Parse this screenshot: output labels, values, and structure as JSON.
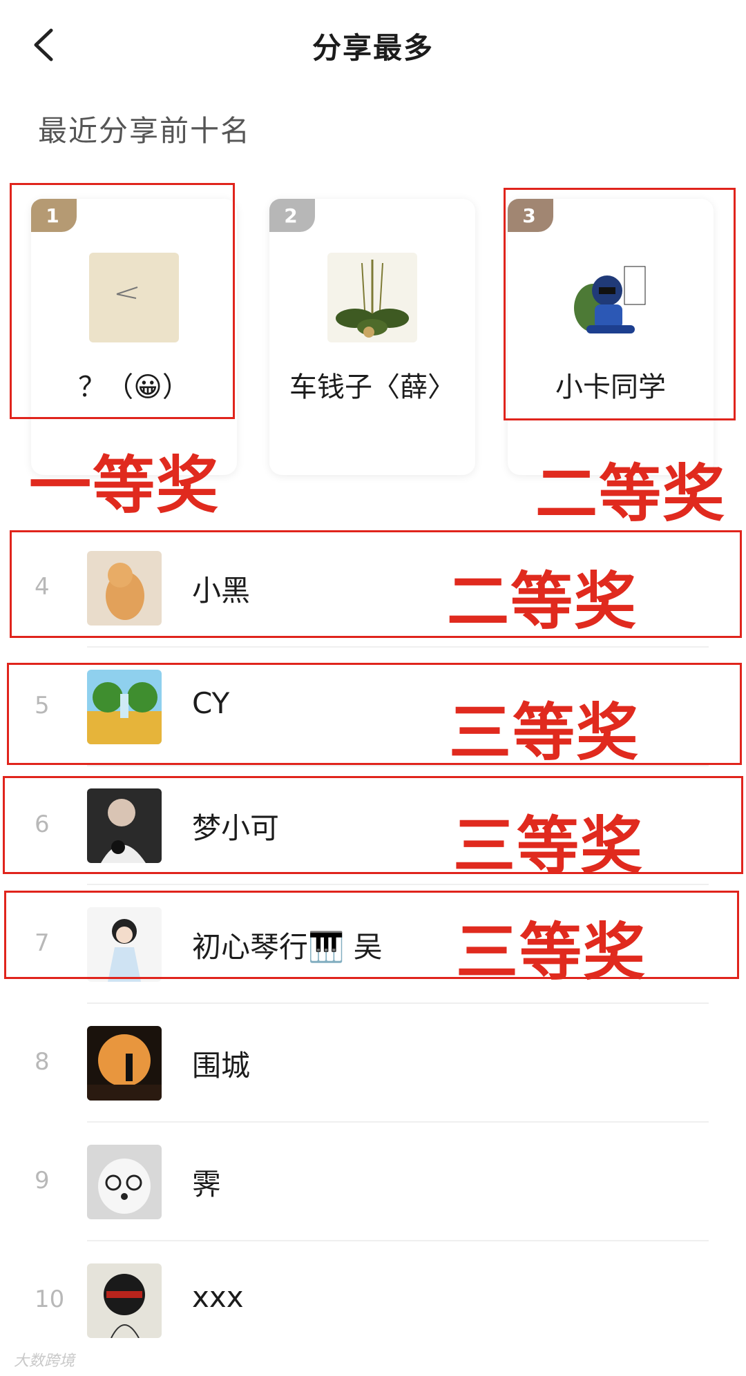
{
  "header": {
    "title": "分享最多",
    "back_icon": "chevron-left-icon"
  },
  "section_title": "最近分享前十名",
  "top3": [
    {
      "rank": "1",
      "name": "？（😀）",
      "badge_color": "#b59a73"
    },
    {
      "rank": "2",
      "name": "车钱子〈薛〉",
      "badge_color": "#b7b7b7"
    },
    {
      "rank": "3",
      "name": "小卡同学",
      "badge_color": "#a18672"
    }
  ],
  "list": [
    {
      "rank": "4",
      "name": "小黑"
    },
    {
      "rank": "5",
      "name": "CY"
    },
    {
      "rank": "6",
      "name": "梦小可"
    },
    {
      "rank": "7",
      "name": "初心琴行🎹 吴"
    },
    {
      "rank": "8",
      "name": "围城"
    },
    {
      "rank": "9",
      "name": "霁"
    },
    {
      "rank": "10",
      "name": "xxx"
    }
  ],
  "annotations": {
    "first": "一等奖",
    "second_a": "二等奖",
    "second_b": "二等奖",
    "third_a": "三等奖",
    "third_b": "三等奖",
    "third_c": "三等奖"
  },
  "colors": {
    "annotation_red": "#e0241c",
    "rank_gray": "#b8b8b8"
  },
  "watermark": "大数跨境"
}
